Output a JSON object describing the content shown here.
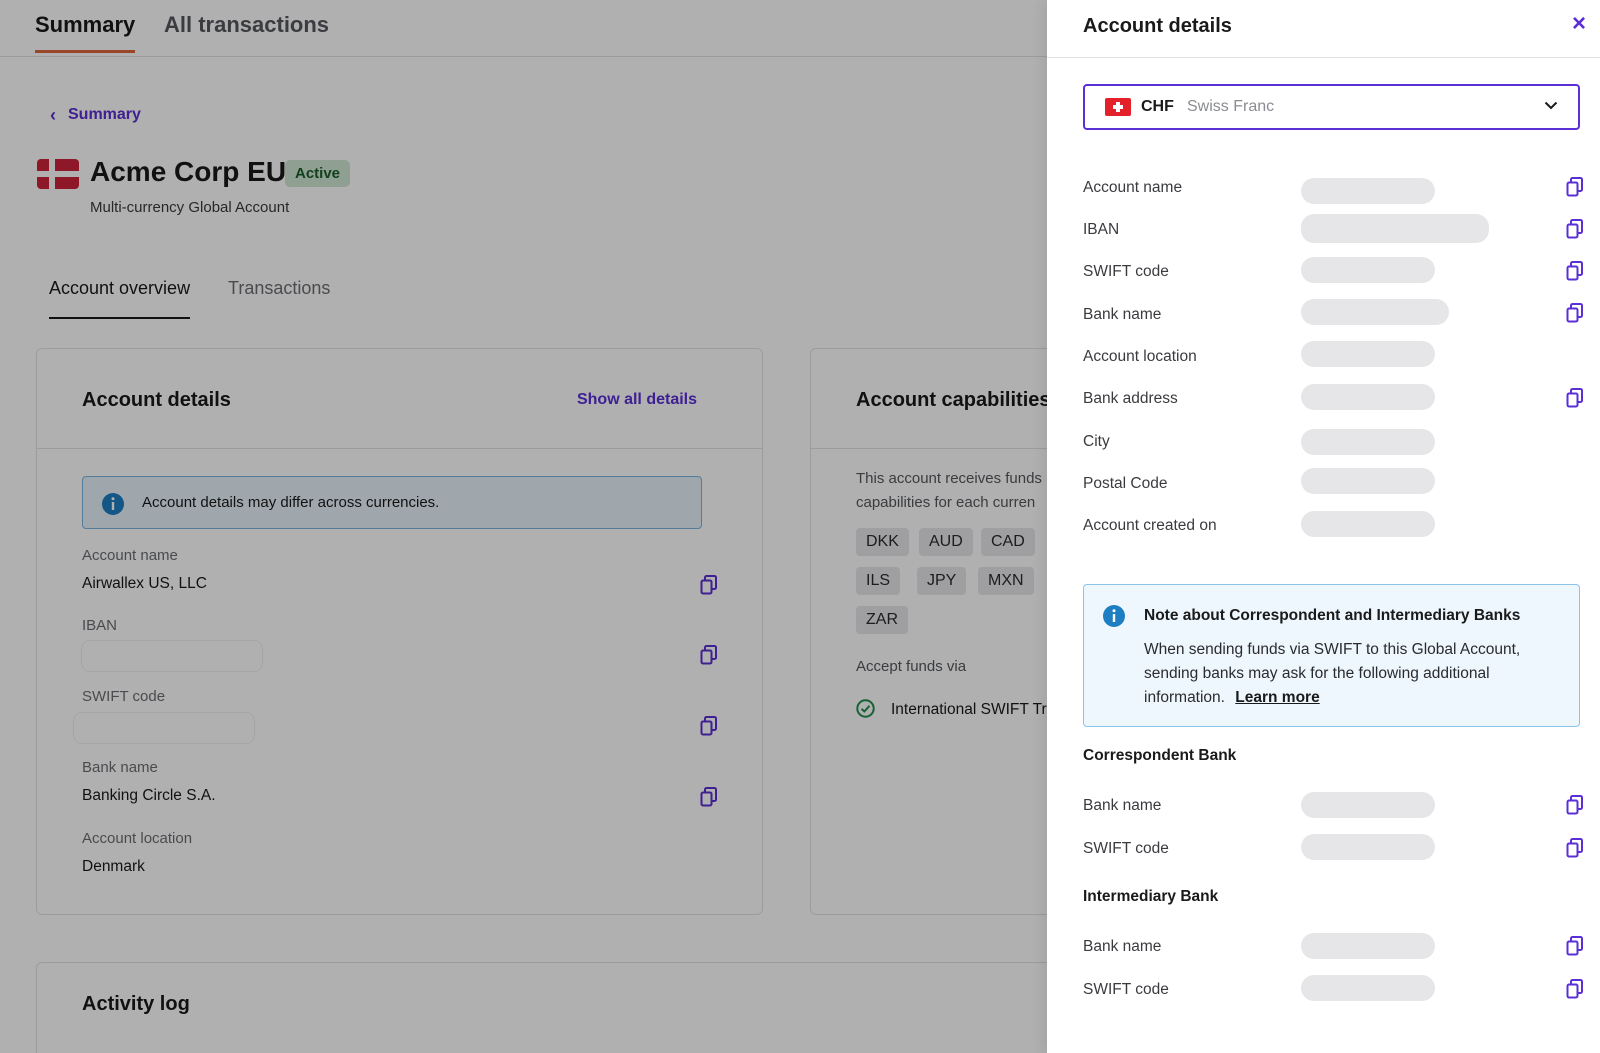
{
  "top_tabs": {
    "summary": "Summary",
    "all_transactions": "All transactions"
  },
  "back_link": "Summary",
  "account": {
    "name": "Acme Corp EU",
    "status": "Active",
    "subtitle": "Multi-currency Global Account"
  },
  "sub_tabs": {
    "overview": "Account overview",
    "transactions": "Transactions"
  },
  "details_card": {
    "title": "Account details",
    "show_all": "Show all details",
    "info": "Account details may differ across currencies.",
    "fields": {
      "account_name_label": "Account name",
      "account_name_value": "Airwallex US, LLC",
      "iban_label": "IBAN",
      "swift_label": "SWIFT code",
      "bank_name_label": "Bank name",
      "bank_name_value": "Banking Circle S.A.",
      "location_label": "Account location",
      "location_value": "Denmark"
    }
  },
  "capabilities_card": {
    "title": "Account capabilities",
    "text": "This account receives funds capabilities for each curren",
    "chips": [
      "DKK",
      "AUD",
      "CAD",
      "ILS",
      "JPY",
      "MXN",
      "ZAR"
    ],
    "accept_label": "Accept funds via",
    "swift_method": "International SWIFT Tr"
  },
  "activity_card": {
    "title": "Activity log"
  },
  "drawer": {
    "title": "Account details",
    "close": "×",
    "currency": {
      "code": "CHF",
      "name": "Swiss Franc"
    },
    "fields": {
      "account_name": "Account name",
      "iban": "IBAN",
      "swift_code": "SWIFT code",
      "bank_name": "Bank name",
      "account_location": "Account location",
      "bank_address": "Bank address",
      "city": "City",
      "postal_code": "Postal Code",
      "created_on": "Account created on"
    },
    "note": {
      "title": "Note about Correspondent and Intermediary Banks",
      "body": "When sending funds via SWIFT to this Global Account, sending banks may ask for the following additional information.",
      "link": "Learn more"
    },
    "correspondent": {
      "heading": "Correspondent Bank",
      "bank_name": "Bank name",
      "swift_code": "SWIFT code"
    },
    "intermediary": {
      "heading": "Intermediary Bank",
      "bank_name": "Bank name",
      "swift_code": "SWIFT code"
    }
  },
  "colors": {
    "accent": "#5b2fd6",
    "tab_underline": "#e0663a",
    "status_bg": "#cfe8d4",
    "info_blue": "#1d7fc2"
  }
}
